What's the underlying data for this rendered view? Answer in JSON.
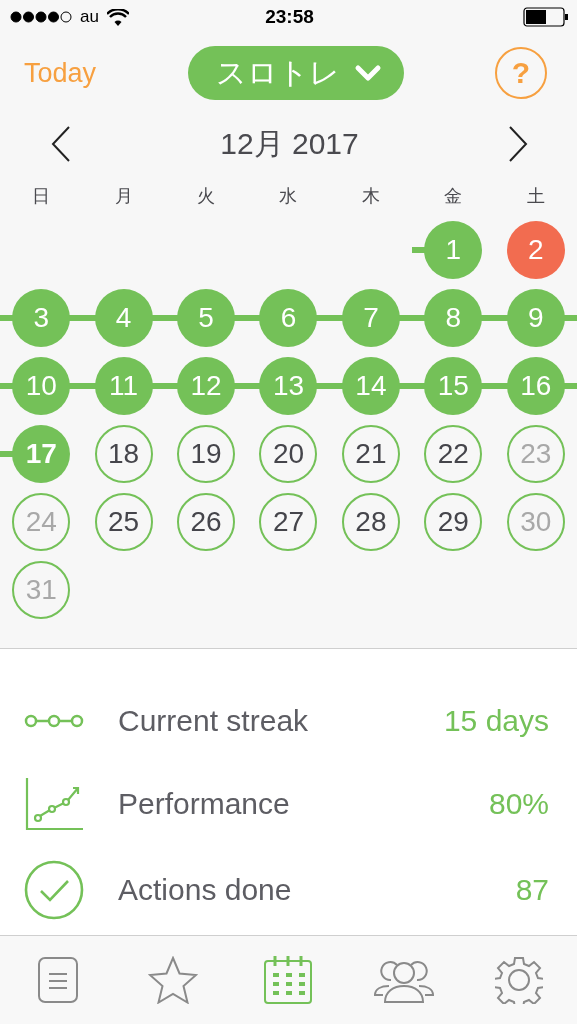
{
  "status_bar": {
    "carrier": "au",
    "time": "23:58"
  },
  "header": {
    "today_button": "Today",
    "plan_selector": "スロトレ",
    "help_button": "?"
  },
  "month_nav": {
    "title": "12月 2017"
  },
  "weekdays": [
    "日",
    "月",
    "火",
    "水",
    "木",
    "金",
    "土"
  ],
  "weeks": [
    [
      {
        "kind": "blank"
      },
      {
        "kind": "blank"
      },
      {
        "kind": "blank"
      },
      {
        "kind": "blank"
      },
      {
        "kind": "blank"
      },
      {
        "label": "1",
        "kind": "done",
        "streak": true,
        "today": false
      },
      {
        "label": "2",
        "kind": "missed",
        "streak": false,
        "today": false
      }
    ],
    [
      {
        "label": "3",
        "kind": "done",
        "streak": true,
        "today": false
      },
      {
        "label": "4",
        "kind": "done",
        "streak": true,
        "today": false
      },
      {
        "label": "5",
        "kind": "done",
        "streak": true,
        "today": false
      },
      {
        "label": "6",
        "kind": "done",
        "streak": true,
        "today": false
      },
      {
        "label": "7",
        "kind": "done",
        "streak": true,
        "today": false
      },
      {
        "label": "8",
        "kind": "done",
        "streak": true,
        "today": false
      },
      {
        "label": "9",
        "kind": "done",
        "streak": true,
        "today": false
      }
    ],
    [
      {
        "label": "10",
        "kind": "done",
        "streak": true,
        "today": false
      },
      {
        "label": "11",
        "kind": "done",
        "streak": true,
        "today": false
      },
      {
        "label": "12",
        "kind": "done",
        "streak": true,
        "today": false
      },
      {
        "label": "13",
        "kind": "done",
        "streak": true,
        "today": false
      },
      {
        "label": "14",
        "kind": "done",
        "streak": true,
        "today": false
      },
      {
        "label": "15",
        "kind": "done",
        "streak": true,
        "today": false
      },
      {
        "label": "16",
        "kind": "done",
        "streak": true,
        "today": false
      }
    ],
    [
      {
        "label": "17",
        "kind": "done",
        "streak": true,
        "today": true
      },
      {
        "label": "18",
        "kind": "planned",
        "streak": false,
        "today": false
      },
      {
        "label": "19",
        "kind": "planned",
        "streak": false,
        "today": false
      },
      {
        "label": "20",
        "kind": "planned",
        "streak": false,
        "today": false
      },
      {
        "label": "21",
        "kind": "planned",
        "streak": false,
        "today": false
      },
      {
        "label": "22",
        "kind": "planned",
        "streak": false,
        "today": false
      },
      {
        "label": "23",
        "kind": "rest",
        "streak": false,
        "today": false
      }
    ],
    [
      {
        "label": "24",
        "kind": "rest",
        "streak": false,
        "today": false
      },
      {
        "label": "25",
        "kind": "planned",
        "streak": false,
        "today": false
      },
      {
        "label": "26",
        "kind": "planned",
        "streak": false,
        "today": false
      },
      {
        "label": "27",
        "kind": "planned",
        "streak": false,
        "today": false
      },
      {
        "label": "28",
        "kind": "planned",
        "streak": false,
        "today": false
      },
      {
        "label": "29",
        "kind": "planned",
        "streak": false,
        "today": false
      },
      {
        "label": "30",
        "kind": "rest",
        "streak": false,
        "today": false
      }
    ],
    [
      {
        "label": "31",
        "kind": "rest",
        "streak": false,
        "today": false
      }
    ]
  ],
  "stats": [
    {
      "kind": "streak",
      "label": "Current streak",
      "value": "15 days"
    },
    {
      "kind": "performance",
      "label": "Performance",
      "value": "80%"
    },
    {
      "kind": "done",
      "label": "Actions done",
      "value": "87"
    }
  ],
  "tab_bar": [
    {
      "kind": "list",
      "selected": false
    },
    {
      "kind": "star",
      "selected": false
    },
    {
      "kind": "calendar",
      "selected": true
    },
    {
      "kind": "people",
      "selected": false
    },
    {
      "kind": "settings",
      "selected": false
    }
  ]
}
